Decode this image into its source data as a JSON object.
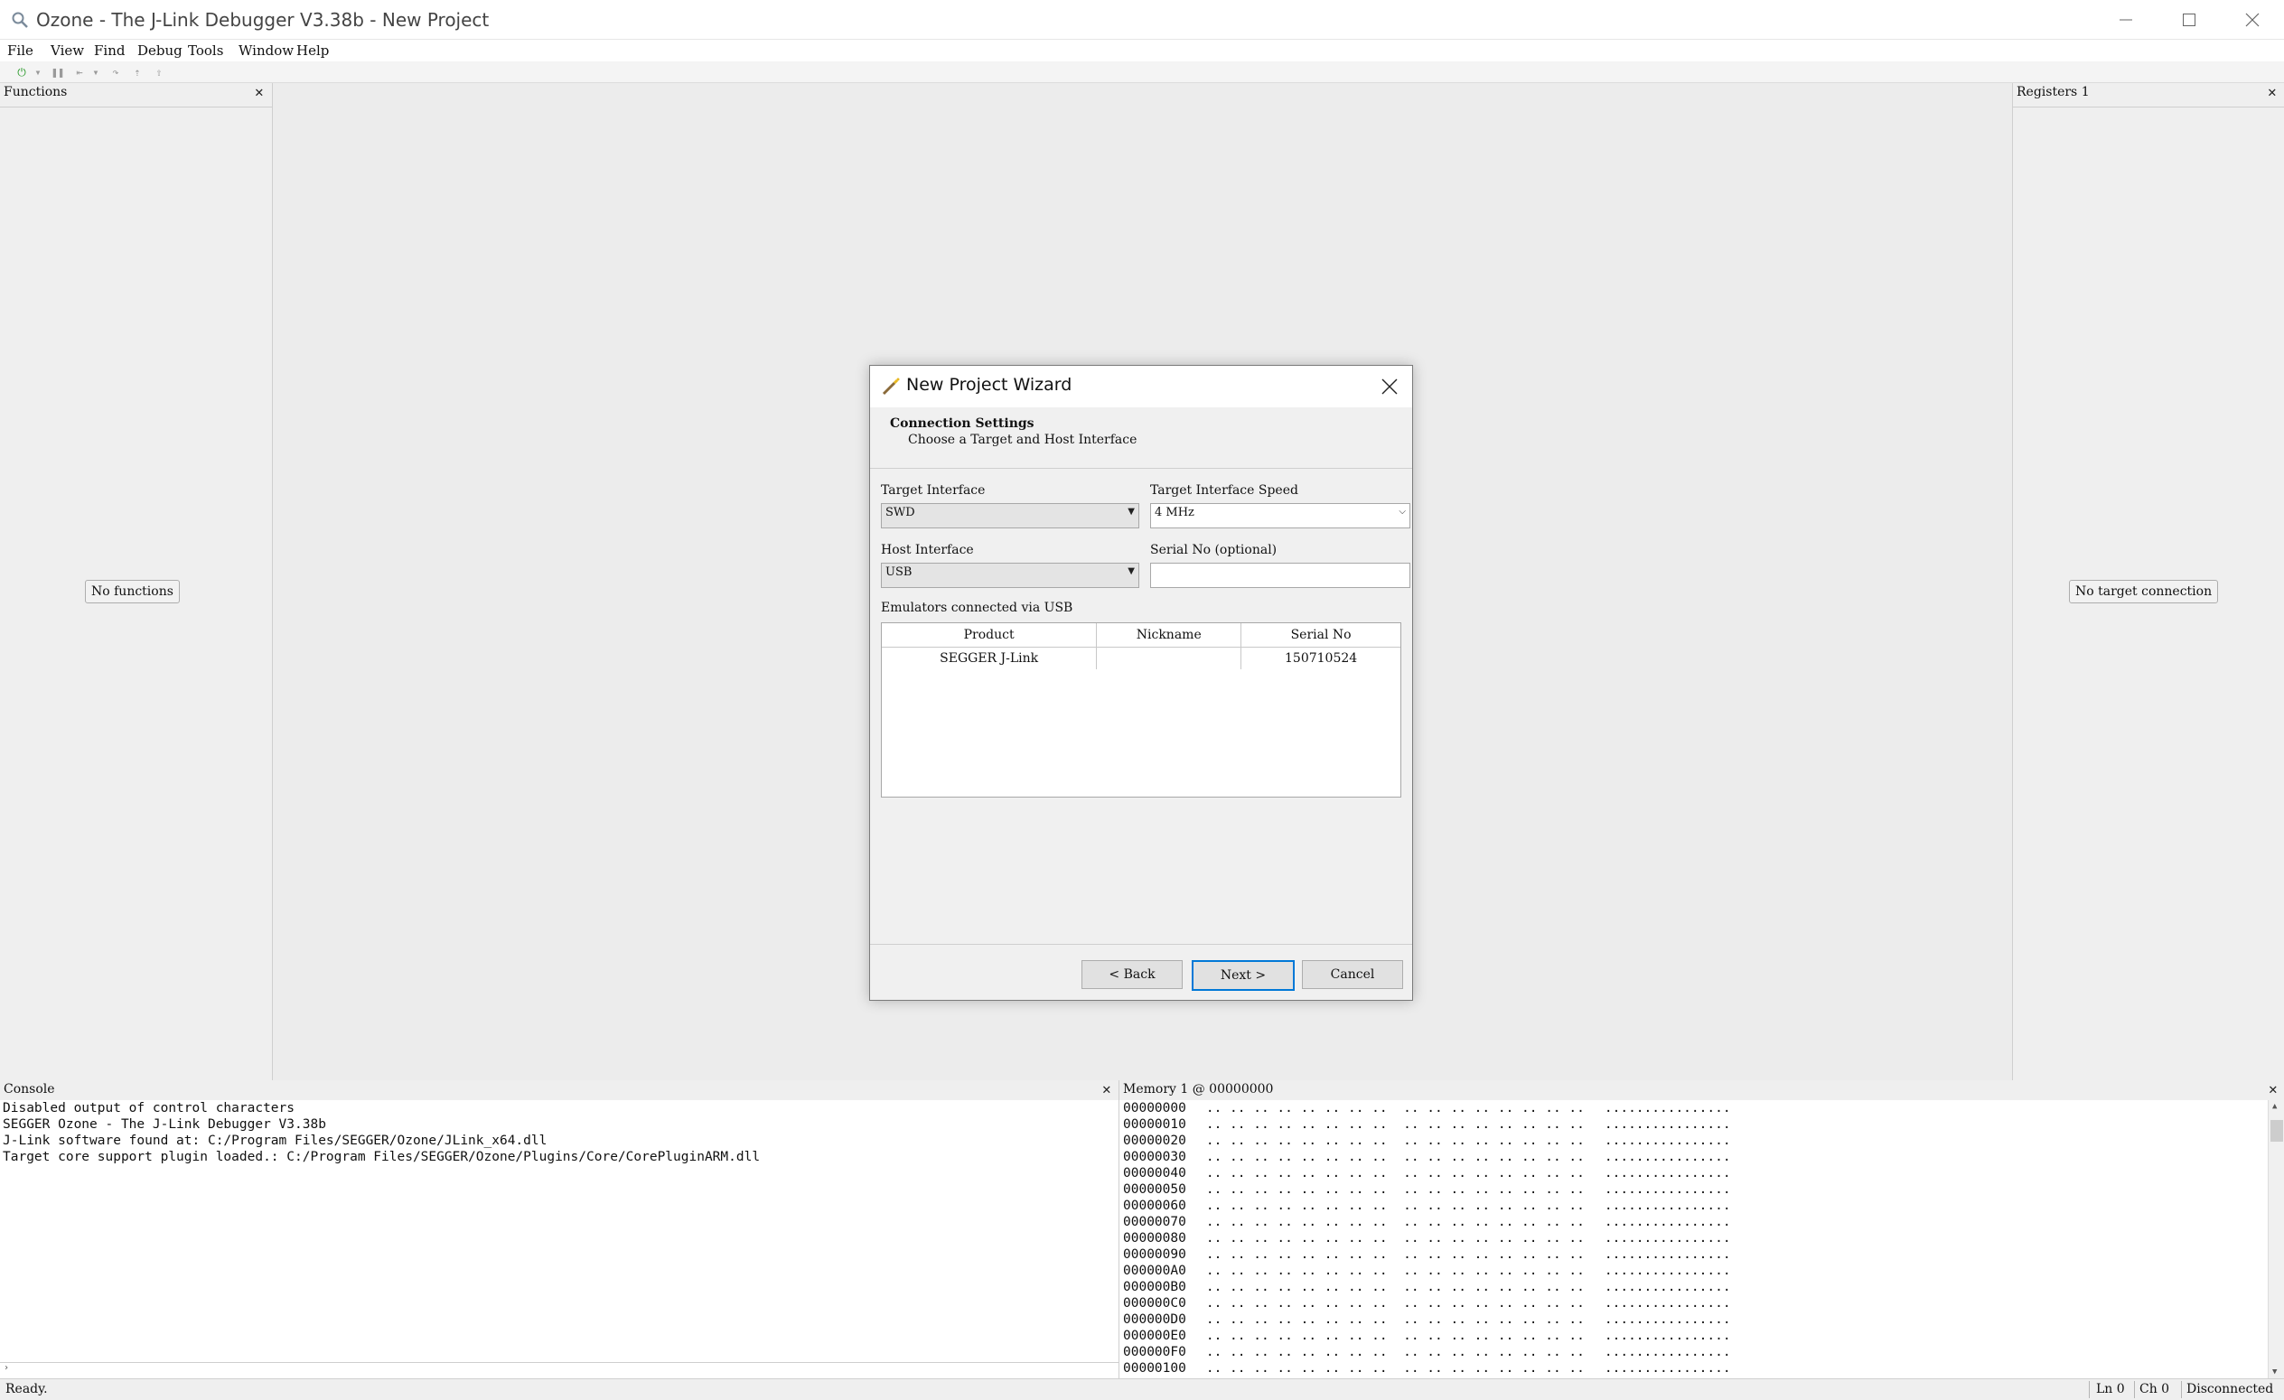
{
  "window": {
    "title": "Ozone - The J-Link Debugger V3.38b - New Project",
    "controls": [
      "minimize",
      "maximize",
      "close"
    ]
  },
  "menu": [
    "File",
    "View",
    "Find",
    "Debug",
    "Tools",
    "Window",
    "Help"
  ],
  "functions_panel": {
    "title": "Functions",
    "empty_text": "No functions"
  },
  "registers_panel": {
    "title": "Registers 1",
    "empty_text": "No target connection"
  },
  "console": {
    "title": "Console",
    "lines": [
      "Disabled output of control characters",
      "SEGGER Ozone - The J-Link Debugger V3.38b",
      "J-Link software found at: C:/Program Files/SEGGER/Ozone/JLink_x64.dll",
      "Target core support plugin loaded.: C:/Program Files/SEGGER/Ozone/Plugins/Core/CorePluginARM.dll"
    ]
  },
  "memory": {
    "title": "Memory 1 @ 00000000",
    "addresses": [
      "00000000",
      "00000010",
      "00000020",
      "00000030",
      "00000040",
      "00000050",
      "00000060",
      "00000070",
      "00000080",
      "00000090",
      "000000A0",
      "000000B0",
      "000000C0",
      "000000D0",
      "000000E0",
      "000000F0",
      "00000100"
    ],
    "bytes_row": ".. .. .. .. .. .. .. ..  .. .. .. .. .. .. .. ..",
    "ascii_row": "................"
  },
  "statusbar": {
    "status": "Ready.",
    "line": "Ln 0",
    "col": "Ch 0",
    "connection": "Disconnected"
  },
  "dialog": {
    "title": "New Project Wizard",
    "header_title": "Connection Settings",
    "header_subtitle": "Choose a Target and Host Interface",
    "target_interface_label": "Target Interface",
    "target_interface_value": "SWD",
    "speed_label": "Target Interface Speed",
    "speed_value": "4 MHz",
    "host_interface_label": "Host Interface",
    "host_interface_value": "USB",
    "serial_label": "Serial No (optional)",
    "serial_value": "",
    "emulators_label": "Emulators connected via USB",
    "table_headers": [
      "Product",
      "Nickname",
      "Serial No"
    ],
    "table_rows": [
      [
        "SEGGER J-Link",
        "",
        "150710524"
      ]
    ],
    "back_label": "< Back",
    "next_label": "Next >",
    "cancel_label": "Cancel"
  }
}
